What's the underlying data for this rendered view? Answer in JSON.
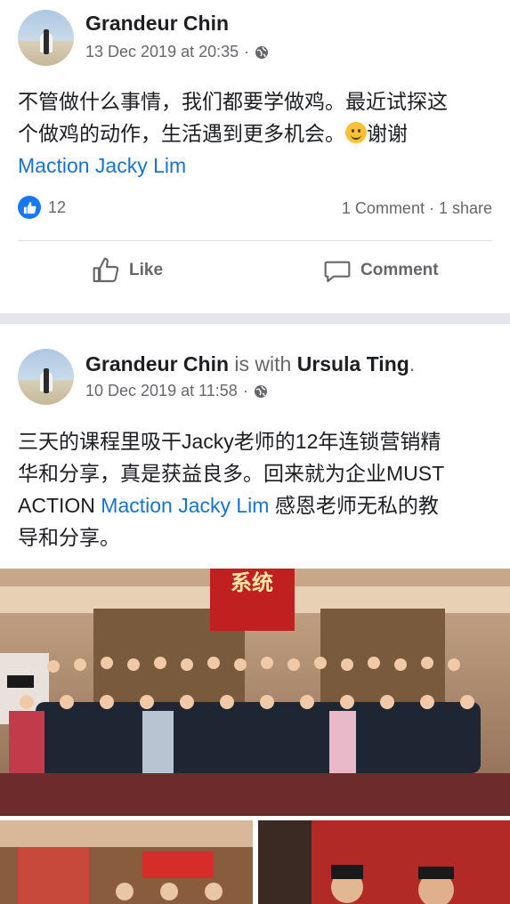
{
  "post1": {
    "author": "Grandeur Chin",
    "timestamp": "13 Dec 2019 at 20:35",
    "meta_dot": "·",
    "privacy_icon": "globe-icon",
    "text_line1": "不管做什么事情，我们都要学做鸡。最近试探这",
    "text_line2a": "个做鸡的动作，生活遇到更多机会。",
    "text_line2b": "谢谢",
    "mention": "Maction Jacky Lim",
    "reaction_count": "12",
    "comments_shares": "1 Comment · 1 share",
    "like_label": "Like",
    "comment_label": "Comment"
  },
  "post2": {
    "author": "Grandeur Chin",
    "with_text": "is with",
    "tagged": "Ursula Ting",
    "period": ".",
    "timestamp": "10 Dec 2019 at 11:58",
    "meta_dot": "·",
    "privacy_icon": "globe-icon",
    "text_line1": "三天的课程里吸干Jacky老师的12年连锁营销精",
    "text_line2": "华和分享，真是获益良多。回来就为企业MUST",
    "text_line3a": "ACTION",
    "mention": "Maction Jacky Lim",
    "text_line3b": "感恩老师无私的教",
    "text_line4": "导和分享。",
    "banner_text": "系统"
  },
  "colors": {
    "link": "#1a73c9",
    "like_blue": "#1877f2",
    "muted": "#65676b",
    "banner_red": "#c0201f"
  }
}
